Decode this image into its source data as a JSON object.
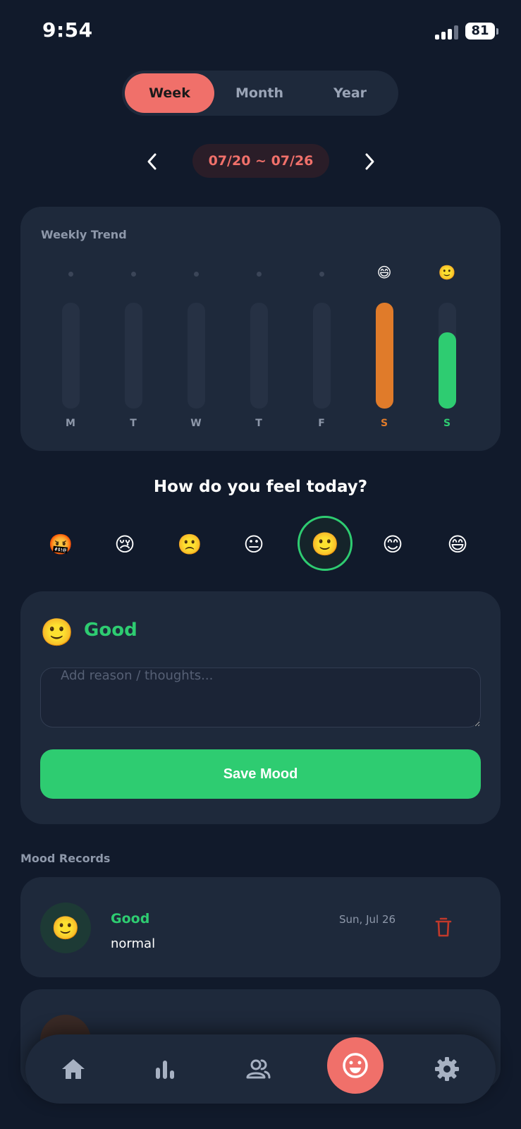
{
  "status_bar": {
    "time": "9:54",
    "battery": "81"
  },
  "period_tabs": [
    {
      "label": "Week",
      "active": true
    },
    {
      "label": "Month",
      "active": false
    },
    {
      "label": "Year",
      "active": false
    }
  ],
  "date_range": "07/20 ~ 07/26",
  "trend": {
    "title": "Weekly Trend",
    "days": [
      {
        "label": "M",
        "emoji": "",
        "level": 0,
        "color": ""
      },
      {
        "label": "T",
        "emoji": "",
        "level": 0,
        "color": ""
      },
      {
        "label": "W",
        "emoji": "",
        "level": 0,
        "color": ""
      },
      {
        "label": "T",
        "emoji": "",
        "level": 0,
        "color": ""
      },
      {
        "label": "F",
        "emoji": "",
        "level": 0,
        "color": ""
      },
      {
        "label": "S",
        "emoji": "😄",
        "level": 1.0,
        "color": "#e07b2a"
      },
      {
        "label": "S",
        "emoji": "🙂",
        "level": 0.72,
        "color": "#2ecc71"
      }
    ]
  },
  "question": "How do you feel today?",
  "mood_options": [
    {
      "emoji": "🤬",
      "name": "furious"
    },
    {
      "emoji": "😢",
      "name": "crying"
    },
    {
      "emoji": "🙁",
      "name": "sad"
    },
    {
      "emoji": "😐",
      "name": "neutral"
    },
    {
      "emoji": "🙂",
      "name": "good",
      "selected": true
    },
    {
      "emoji": "😊",
      "name": "happy"
    },
    {
      "emoji": "😄",
      "name": "great"
    }
  ],
  "selected_mood": {
    "emoji": "🙂",
    "label": "Good",
    "reason_placeholder": "Add reason / thoughts...",
    "save_label": "Save Mood"
  },
  "records": {
    "title": "Mood Records",
    "items": [
      {
        "emoji": "🙂",
        "mood": "Good",
        "note": "normal",
        "date": "Sun, Jul 26"
      }
    ]
  },
  "colors": {
    "accent": "#f0706a",
    "good": "#2ecc71",
    "great": "#e07b2a",
    "background": "#111a2b",
    "card": "#1e293b"
  },
  "bottom_nav": [
    "home-icon",
    "stats-icon",
    "people-icon",
    "mood-icon",
    "gear-icon"
  ]
}
